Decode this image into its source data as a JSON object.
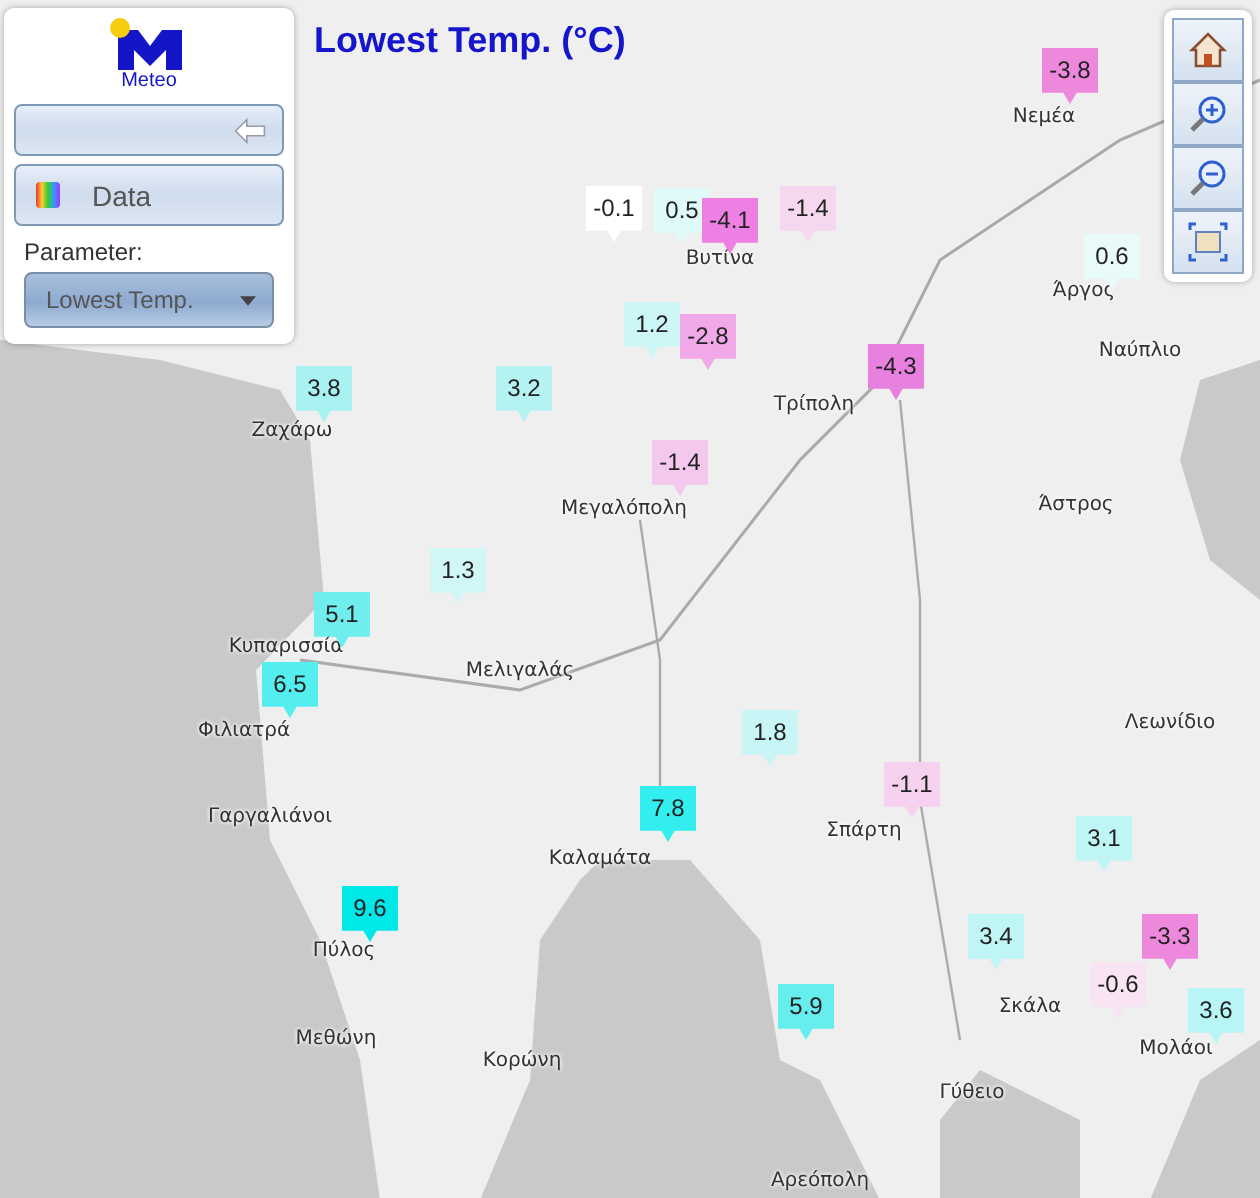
{
  "title": "Lowest Temp. (°C)",
  "panel": {
    "logo_text": "Meteo",
    "data_button": "Data",
    "parameter_label": "Parameter:",
    "parameter_value": "Lowest Temp."
  },
  "places": [
    "Νεμέα",
    "Βυτίνα",
    "Άργος",
    "Ναύπλιο",
    "Τρίπολη",
    "Ζαχάρω",
    "Άστρος",
    "Μεγαλόπολη",
    "Κυπαρισσία",
    "Μελιγαλάς",
    "Λεωνίδιο",
    "Φιλιατρά",
    "Γαργαλιάνοι",
    "Καλαμάτα",
    "Σπάρτη",
    "Πύλος",
    "Μεθώνη",
    "Κορώνη",
    "Σκάλα",
    "Μολάοι",
    "Γύθειο",
    "Αρεόπολη"
  ],
  "markers": [
    {
      "value": "-3.8",
      "color": "#ee88dd"
    },
    {
      "value": "-0.1",
      "color": "#ffffff"
    },
    {
      "value": "0.5",
      "color": "#e0fafa"
    },
    {
      "value": "-4.1",
      "color": "#ee80e4"
    },
    {
      "value": "-1.4",
      "color": "#f5d8ef"
    },
    {
      "value": "0.6",
      "color": "#e8fafa"
    },
    {
      "value": "1.2",
      "color": "#cdf6f6"
    },
    {
      "value": "-2.8",
      "color": "#f0a8e8"
    },
    {
      "value": "-4.3",
      "color": "#e880e0"
    },
    {
      "value": "3.8",
      "color": "#a8f2f2"
    },
    {
      "value": "3.2",
      "color": "#b5f2f2"
    },
    {
      "value": "-1.4",
      "color": "#f4c8ec"
    },
    {
      "value": "1.3",
      "color": "#d0f6f6"
    },
    {
      "value": "5.1",
      "color": "#70eeee"
    },
    {
      "value": "6.5",
      "color": "#55eeee"
    },
    {
      "value": "1.8",
      "color": "#c8f5f5"
    },
    {
      "value": "-1.1",
      "color": "#f5d0ef"
    },
    {
      "value": "7.8",
      "color": "#33eeee"
    },
    {
      "value": "3.1",
      "color": "#c0f5f5"
    },
    {
      "value": "9.6",
      "color": "#00e8e8"
    },
    {
      "value": "3.4",
      "color": "#bff5f5"
    },
    {
      "value": "-3.3",
      "color": "#ee88dd"
    },
    {
      "value": "-0.6",
      "color": "#f8e4f3"
    },
    {
      "value": "3.6",
      "color": "#b8f5f5"
    },
    {
      "value": "5.9",
      "color": "#66eeee"
    }
  ]
}
